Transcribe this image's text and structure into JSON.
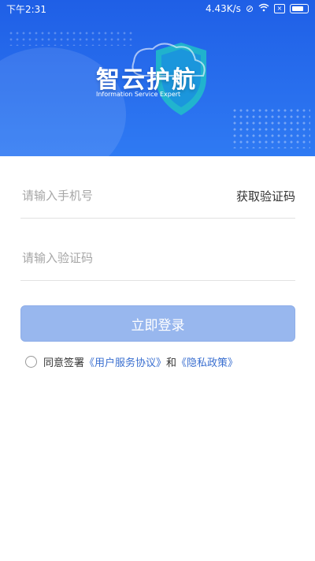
{
  "status_bar": {
    "time": "下午2:31",
    "speed": "4.43K/s"
  },
  "header": {
    "logo_title": "智云护航",
    "logo_subtitle": "Information Service Expert"
  },
  "form": {
    "phone_placeholder": "请输入手机号",
    "get_code_label": "获取验证码",
    "code_placeholder": "请输入验证码"
  },
  "login_button_label": "立即登录",
  "agreement": {
    "prefix": "同意签署",
    "user_agreement": "《用户服务协议》",
    "and": "和",
    "privacy_policy": "《隐私政策》"
  },
  "colors": {
    "header_blue": "#2f7af3",
    "button_disabled": "#98b7ee",
    "link": "#3a6fd0"
  }
}
